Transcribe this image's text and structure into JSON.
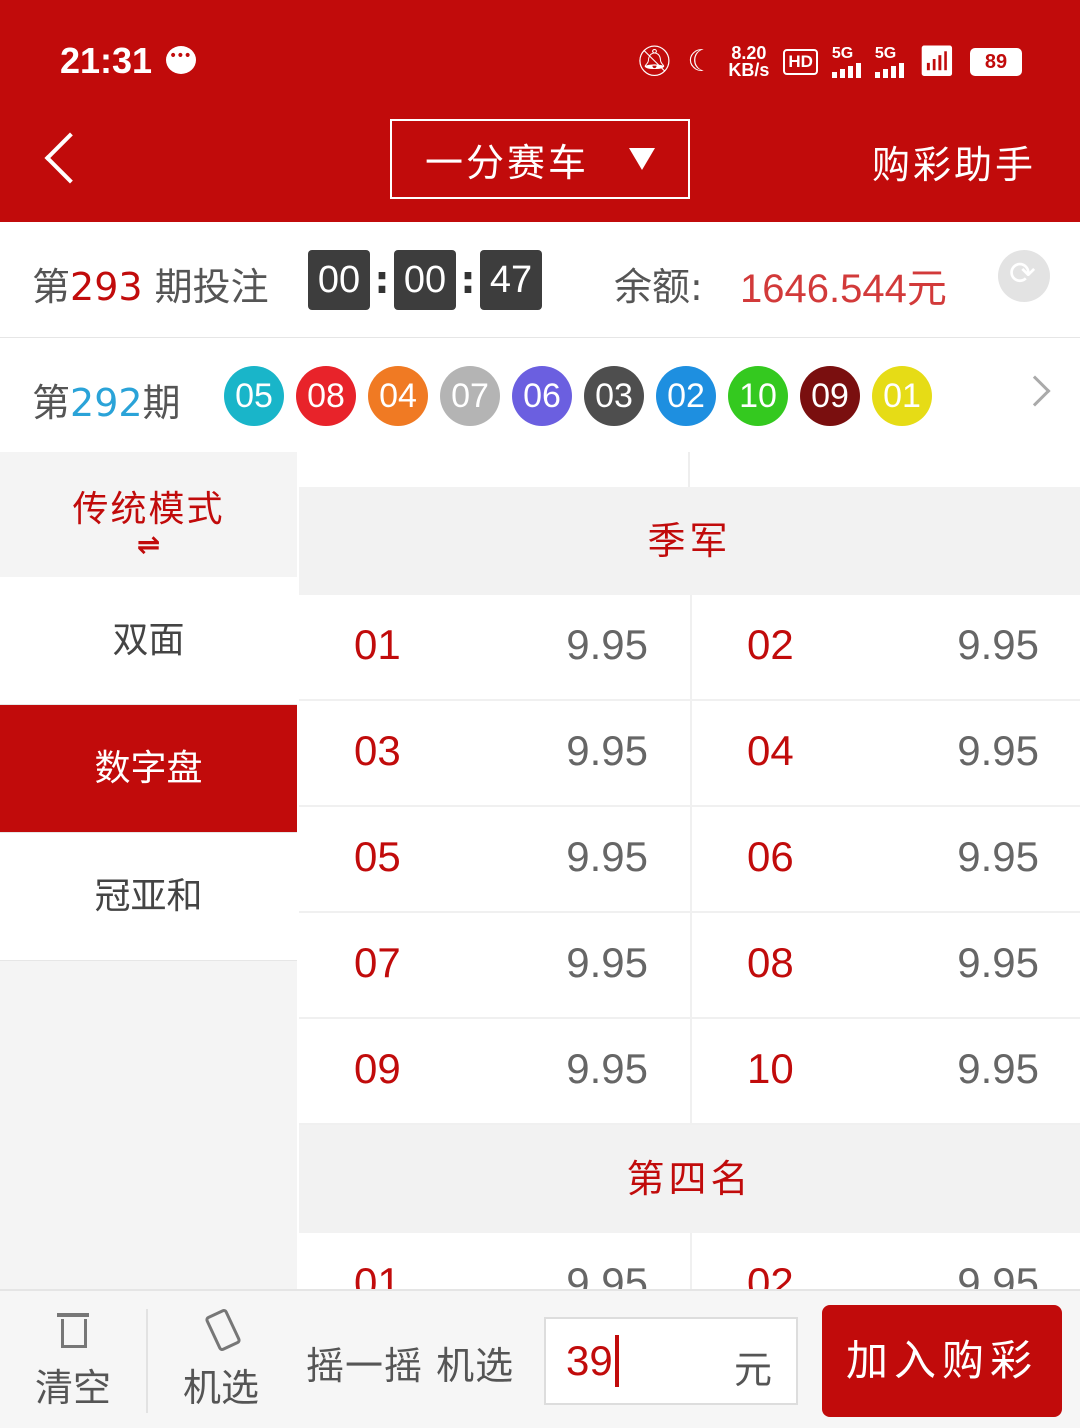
{
  "status_bar": {
    "time": "21:31",
    "net_speed_value": "8.20",
    "net_speed_unit": "KB/s",
    "hd_label": "HD",
    "sim1_label": "5G",
    "sim2_label": "5G",
    "battery": "89"
  },
  "header": {
    "game_name": "一分赛车",
    "helper_label": "购彩助手"
  },
  "current_period": {
    "prefix": "第",
    "number": "293",
    "suffix": " 期投注",
    "countdown": [
      "00",
      "00",
      "47"
    ],
    "balance_label": "余额:",
    "balance_value": "1646.544元"
  },
  "last_result": {
    "prefix": "第",
    "number": "292",
    "suffix": "期",
    "balls": [
      {
        "num": "05",
        "color": "#19b5c9"
      },
      {
        "num": "08",
        "color": "#e8232a"
      },
      {
        "num": "04",
        "color": "#f07a23"
      },
      {
        "num": "07",
        "color": "#b4b4b4"
      },
      {
        "num": "06",
        "color": "#6b5fe0"
      },
      {
        "num": "03",
        "color": "#4e4e4e"
      },
      {
        "num": "02",
        "color": "#1e8fe0"
      },
      {
        "num": "10",
        "color": "#34c91f"
      },
      {
        "num": "09",
        "color": "#7a0f0f"
      },
      {
        "num": "01",
        "color": "#e6dc16"
      }
    ]
  },
  "sidebar": {
    "mode_label": "传统模式",
    "mode_swap_glyph": "⇌",
    "items": [
      {
        "label": "双面",
        "active": false
      },
      {
        "label": "数字盘",
        "active": true
      },
      {
        "label": "冠亚和",
        "active": false
      }
    ]
  },
  "sections": [
    {
      "title": "季军",
      "rows": [
        [
          {
            "num": "01",
            "odds": "9.95"
          },
          {
            "num": "02",
            "odds": "9.95"
          }
        ],
        [
          {
            "num": "03",
            "odds": "9.95"
          },
          {
            "num": "04",
            "odds": "9.95"
          }
        ],
        [
          {
            "num": "05",
            "odds": "9.95"
          },
          {
            "num": "06",
            "odds": "9.95"
          }
        ],
        [
          {
            "num": "07",
            "odds": "9.95"
          },
          {
            "num": "08",
            "odds": "9.95"
          }
        ],
        [
          {
            "num": "09",
            "odds": "9.95"
          },
          {
            "num": "10",
            "odds": "9.95"
          }
        ]
      ]
    },
    {
      "title": "第四名",
      "rows": [
        [
          {
            "num": "01",
            "odds": "9.95"
          },
          {
            "num": "02",
            "odds": "9.95"
          }
        ]
      ]
    }
  ],
  "bottom_bar": {
    "clear_label": "清空",
    "random_label": "机选",
    "shake_text": "摇一摇 机选",
    "amount_value": "39",
    "amount_unit": "元",
    "buy_label": "加入购彩"
  },
  "colors": {
    "brand": "#c10b0b",
    "odds_text": "#666666",
    "balance": "#d23a3a"
  }
}
